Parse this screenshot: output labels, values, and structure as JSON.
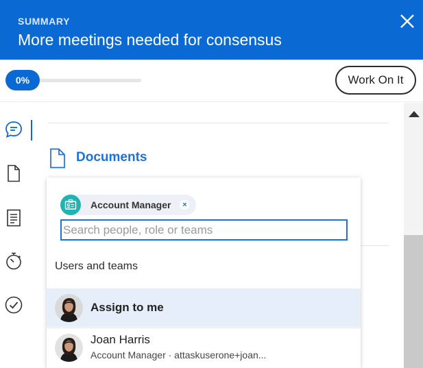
{
  "header": {
    "kicker": "SUMMARY",
    "title": "More meetings needed for consensus",
    "close_icon": "close-icon"
  },
  "progress": {
    "label": "0%",
    "value": 0
  },
  "actions": {
    "work_on_it": "Work On It"
  },
  "rail": {
    "items": [
      "comment-icon",
      "document-icon",
      "list-document-icon",
      "timer-icon",
      "check-circle-icon"
    ],
    "active": "comment-icon"
  },
  "main": {
    "documents_title": "Documents"
  },
  "panel": {
    "chip": {
      "icon": "badge-icon",
      "label": "Account Manager",
      "remove_icon": "remove-icon",
      "remove_glyph": "×"
    },
    "search": {
      "value": "",
      "placeholder": "Search people, role or teams"
    },
    "section_label": "Users and teams",
    "rows": [
      {
        "name": "Assign to me",
        "sub": ""
      },
      {
        "name": "Joan Harris",
        "sub": "Account Manager · attaskuserone+joan..."
      }
    ]
  },
  "colors": {
    "brand_blue": "#0b69d4",
    "link_blue": "#1a73d9",
    "chip_teal": "#23b2b2",
    "highlight_row": "#e6eef9"
  }
}
